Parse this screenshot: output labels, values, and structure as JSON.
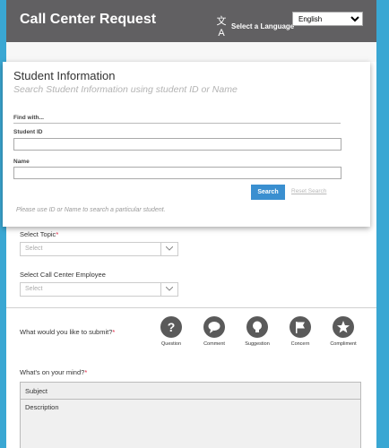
{
  "header": {
    "title": "Call Center Request",
    "language_label": "Select a Language",
    "language_selected": "English"
  },
  "student": {
    "title": "Student Information",
    "subtitle": "Search Student Information using student ID or Name",
    "find_with": "Find with...",
    "id_label": "Student ID",
    "name_label": "Name",
    "search_button": "Search",
    "reset_link": "Reset Search",
    "hint": "Please use ID or Name to search a particular student."
  },
  "topic": {
    "label": "Select Topic",
    "placeholder": "Select"
  },
  "employee": {
    "label": "Select Call Center Employee",
    "placeholder": "Select"
  },
  "submit": {
    "label": "What would you like to submit?",
    "options": [
      {
        "label": "Question",
        "icon": "question-icon"
      },
      {
        "label": "Comment",
        "icon": "comment-icon"
      },
      {
        "label": "Suggestion",
        "icon": "lightbulb-icon"
      },
      {
        "label": "Concern",
        "icon": "flag-icon"
      },
      {
        "label": "Compliment",
        "icon": "star-icon"
      }
    ]
  },
  "mind": {
    "label": "What's on your mind?",
    "subject": "Subject",
    "description": "Description"
  },
  "required_marker": "*",
  "colors": {
    "header": "#616062",
    "accent": "#3a8fd0",
    "background": "#3aa7d3",
    "required": "#e0203f"
  }
}
